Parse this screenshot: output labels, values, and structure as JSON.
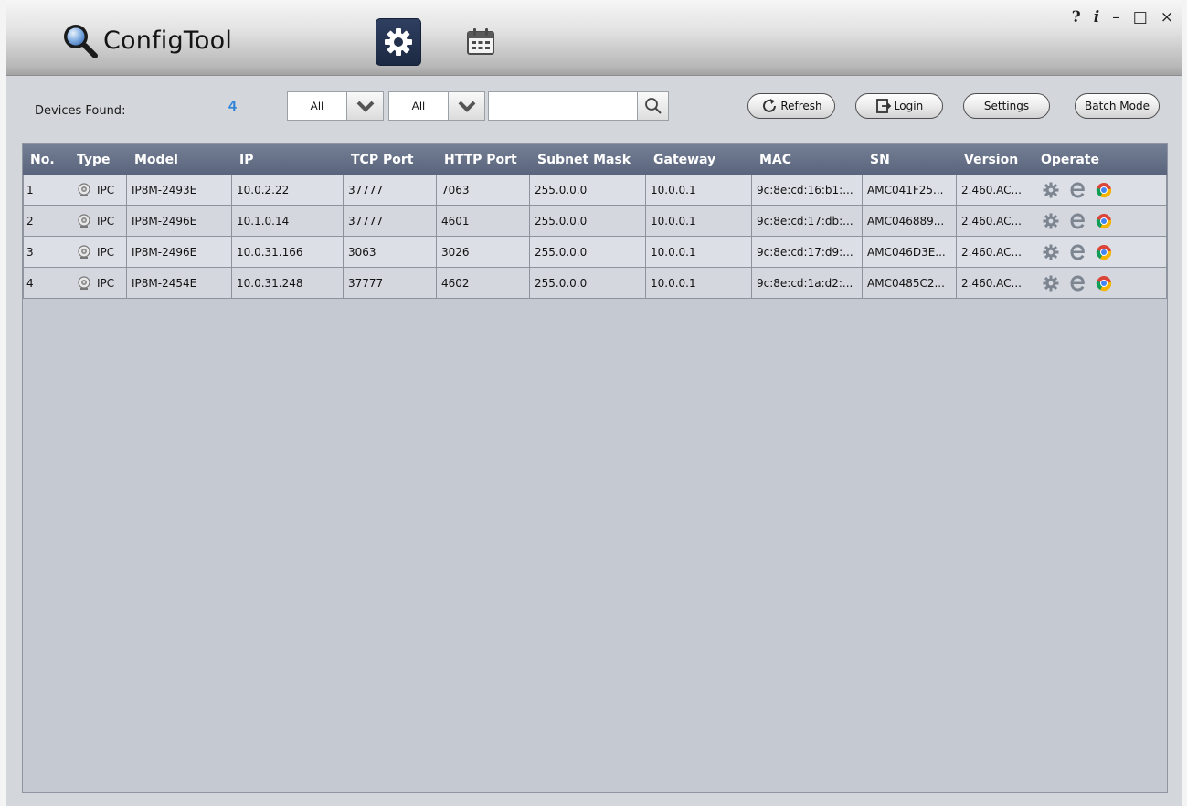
{
  "app": {
    "title": "ConfigTool"
  },
  "window_controls": {
    "help": "?",
    "info": "i",
    "minimize": "–",
    "maximize": "□",
    "close": "×"
  },
  "tabs": [
    {
      "name": "config",
      "icon": "gear-icon",
      "active": true
    },
    {
      "name": "schedule",
      "icon": "calendar-icon",
      "active": false
    }
  ],
  "toolbar": {
    "devices_found_label": "Devices Found:",
    "devices_found_count": "4",
    "filter1": {
      "value": "All"
    },
    "filter2": {
      "value": "All"
    },
    "search": {
      "value": "",
      "placeholder": ""
    },
    "refresh_label": "Refresh",
    "login_label": "Login",
    "settings_label": "Settings",
    "batch_label": "Batch Mode"
  },
  "table": {
    "columns": [
      "No.",
      "Type",
      "Model",
      "IP",
      "TCP Port",
      "HTTP Port",
      "Subnet Mask",
      "Gateway",
      "MAC",
      "SN",
      "Version",
      "Operate"
    ],
    "rows": [
      {
        "no": "1",
        "type": "IPC",
        "model": "IP8M-2493E",
        "ip": "10.0.2.22",
        "tcp": "37777",
        "http": "7063",
        "mask": "255.0.0.0",
        "gateway": "10.0.0.1",
        "mac": "9c:8e:cd:16:b1:...",
        "sn": "AMC041F25...",
        "version": "2.460.AC..."
      },
      {
        "no": "2",
        "type": "IPC",
        "model": "IP8M-2496E",
        "ip": "10.1.0.14",
        "tcp": "37777",
        "http": "4601",
        "mask": "255.0.0.0",
        "gateway": "10.0.0.1",
        "mac": "9c:8e:cd:17:db:...",
        "sn": "AMC046889...",
        "version": "2.460.AC..."
      },
      {
        "no": "3",
        "type": "IPC",
        "model": "IP8M-2496E",
        "ip": "10.0.31.166",
        "tcp": "3063",
        "http": "3026",
        "mask": "255.0.0.0",
        "gateway": "10.0.0.1",
        "mac": "9c:8e:cd:17:d9:...",
        "sn": "AMC046D3E...",
        "version": "2.460.AC..."
      },
      {
        "no": "4",
        "type": "IPC",
        "model": "IP8M-2454E",
        "ip": "10.0.31.248",
        "tcp": "37777",
        "http": "4602",
        "mask": "255.0.0.0",
        "gateway": "10.0.0.1",
        "mac": "9c:8e:cd:1a:d2:...",
        "sn": "AMC0485C2...",
        "version": "2.460.AC..."
      }
    ]
  },
  "colors": {
    "accent_count": "#2f83d6",
    "header_bg": "#5a657d",
    "tab_active_bg": "#1c2942"
  }
}
